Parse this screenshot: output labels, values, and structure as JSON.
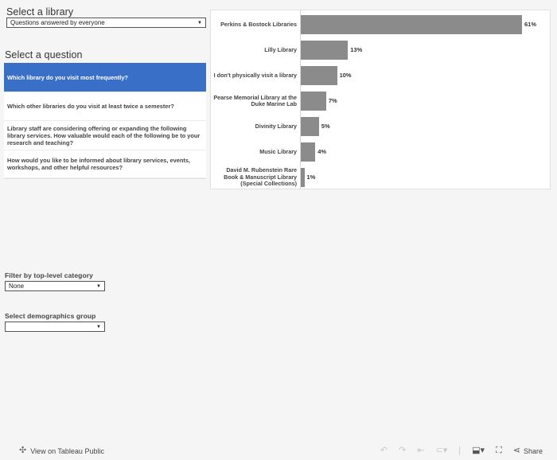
{
  "library_filter": {
    "heading": "Select a library",
    "selected": "Questions answered by everyone"
  },
  "question_filter": {
    "heading": "Select a question",
    "questions": [
      {
        "text": "Which library do you visit most frequently?",
        "selected": true
      },
      {
        "text": "Which other libraries do you visit at least twice a semester?",
        "selected": false
      },
      {
        "text": "Library staff are considering offering or expanding the following library services. How valuable would each of the following be to your research and teaching?",
        "selected": false
      },
      {
        "text": "How would you like to be informed about library services, events, workshops, and other helpful resources?",
        "selected": false
      }
    ]
  },
  "category_filter": {
    "heading": "Filter by top-level category",
    "selected": "None"
  },
  "demographics_filter": {
    "heading": "Select demographics group",
    "selected": ""
  },
  "chart_data": {
    "type": "bar",
    "orientation": "horizontal",
    "categories": [
      "Perkins & Bostock Libraries",
      "Lilly Library",
      "I don't physically visit a library",
      "Pearse Memorial Library at the Duke Marine Lab",
      "Divinity Library",
      "Music Library",
      "David M. Rubenstein Rare Book & Manuscript Library (Special Collections)"
    ],
    "values": [
      61,
      13,
      10,
      7,
      5,
      4,
      1
    ],
    "value_labels": [
      "61%",
      "13%",
      "10%",
      "7%",
      "5%",
      "4%",
      "1%"
    ],
    "bar_color": "#8b8b8b"
  },
  "footer": {
    "view_label": "View on Tableau Public",
    "share_label": "Share"
  }
}
